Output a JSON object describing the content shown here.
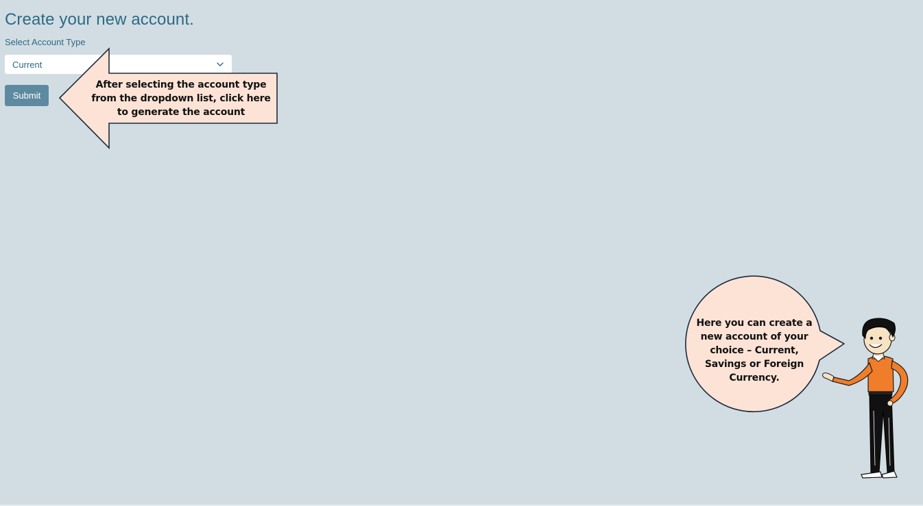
{
  "page": {
    "title": "Create your new account."
  },
  "form": {
    "account_type_label": "Select Account Type",
    "account_type_selected": "Current",
    "submit_label": "Submit"
  },
  "help": {
    "arrow_callout_lines": [
      "After selecting the account type",
      "from the dropdown list, click here",
      "to generate the account"
    ],
    "bubble_lines": [
      "Here you can create a",
      "new account of your",
      "choice – Current,",
      "Savings or Foreign",
      "Currency."
    ]
  },
  "colors": {
    "background": "#d2dde3",
    "accent": "#2d6a85",
    "button": "#5e8aa0",
    "callout_fill": "#fce3d6",
    "callout_stroke": "#1b2a3a",
    "shirt": "#f07d2a"
  },
  "icons": {
    "dropdown": "chevron-down-icon",
    "character": "presenter-character-illustration"
  }
}
